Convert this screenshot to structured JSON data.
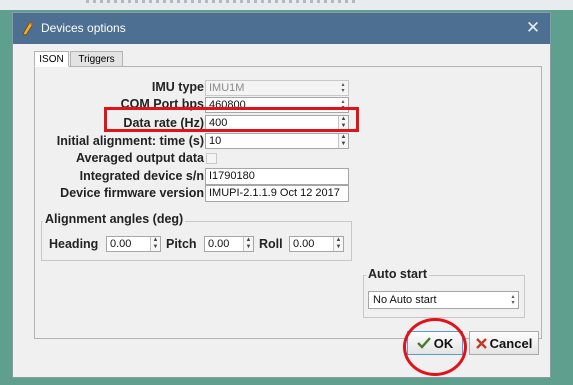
{
  "window": {
    "title": "Devices options",
    "close_glyph": "✕"
  },
  "tabs": [
    {
      "label": "ISON",
      "active": true
    },
    {
      "label": "Triggers",
      "active": false
    }
  ],
  "ison": {
    "imu_type": {
      "label": "IMU type",
      "value": "IMU1M"
    },
    "com_port": {
      "label": "COM Port bps",
      "value": "460800"
    },
    "data_rate": {
      "label": "Data rate (Hz)",
      "value": "400"
    },
    "initial_alignment": {
      "label": "Initial alignment: time (s)",
      "value": "10"
    },
    "averaged_output": {
      "label": "Averaged output data",
      "checked": false
    },
    "serial": {
      "label": "Integrated device s/n",
      "value": "I1790180"
    },
    "firmware": {
      "label": "Device firmware version",
      "value": "IMUPI-2.1.1.9 Oct 12 2017"
    }
  },
  "alignment_angles": {
    "title": "Alignment angles (deg)",
    "heading": {
      "label": "Heading",
      "value": "0.00"
    },
    "pitch": {
      "label": "Pitch",
      "value": "0.00"
    },
    "roll": {
      "label": "Roll",
      "value": "0.00"
    }
  },
  "auto_start": {
    "title": "Auto start",
    "selected": "No Auto start"
  },
  "buttons": {
    "ok": "OK",
    "cancel": "Cancel"
  },
  "icons": {
    "app": "pencil-icon",
    "ok": "check-icon",
    "cancel": "x-icon"
  },
  "colors": {
    "titlebar": "#4d6f92",
    "annotation": "#e0121a",
    "background": "#5e9f8e"
  }
}
